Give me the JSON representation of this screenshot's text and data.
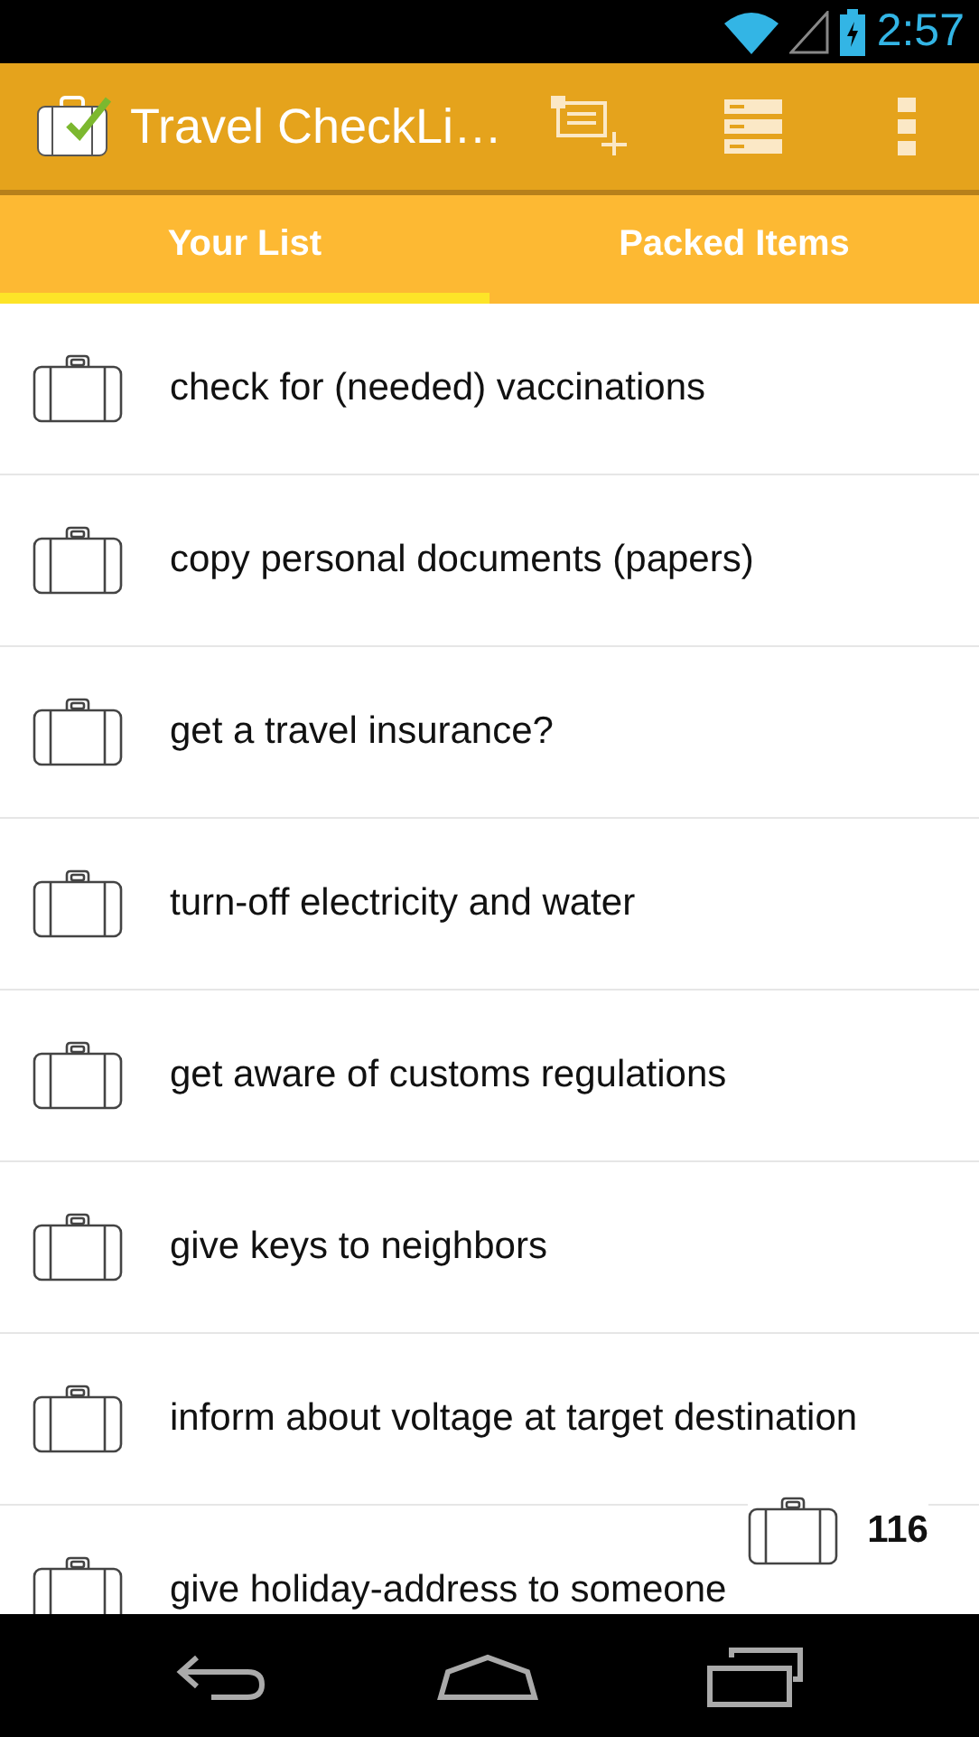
{
  "status_bar": {
    "time": "2:57"
  },
  "action_bar": {
    "title": "Travel CheckLi…"
  },
  "tabs": [
    {
      "label": "Your List",
      "selected": true
    },
    {
      "label": "Packed Items",
      "selected": false
    }
  ],
  "items": [
    {
      "text": "check for (needed) vaccinations"
    },
    {
      "text": "copy personal documents (papers)"
    },
    {
      "text": "get a travel insurance?"
    },
    {
      "text": "turn-off electricity and water"
    },
    {
      "text": "get aware of customs regulations"
    },
    {
      "text": "give keys to neighbors"
    },
    {
      "text": "inform about voltage at target destination"
    },
    {
      "text": "give holiday-address to someone"
    }
  ],
  "counter": {
    "count": "116"
  }
}
